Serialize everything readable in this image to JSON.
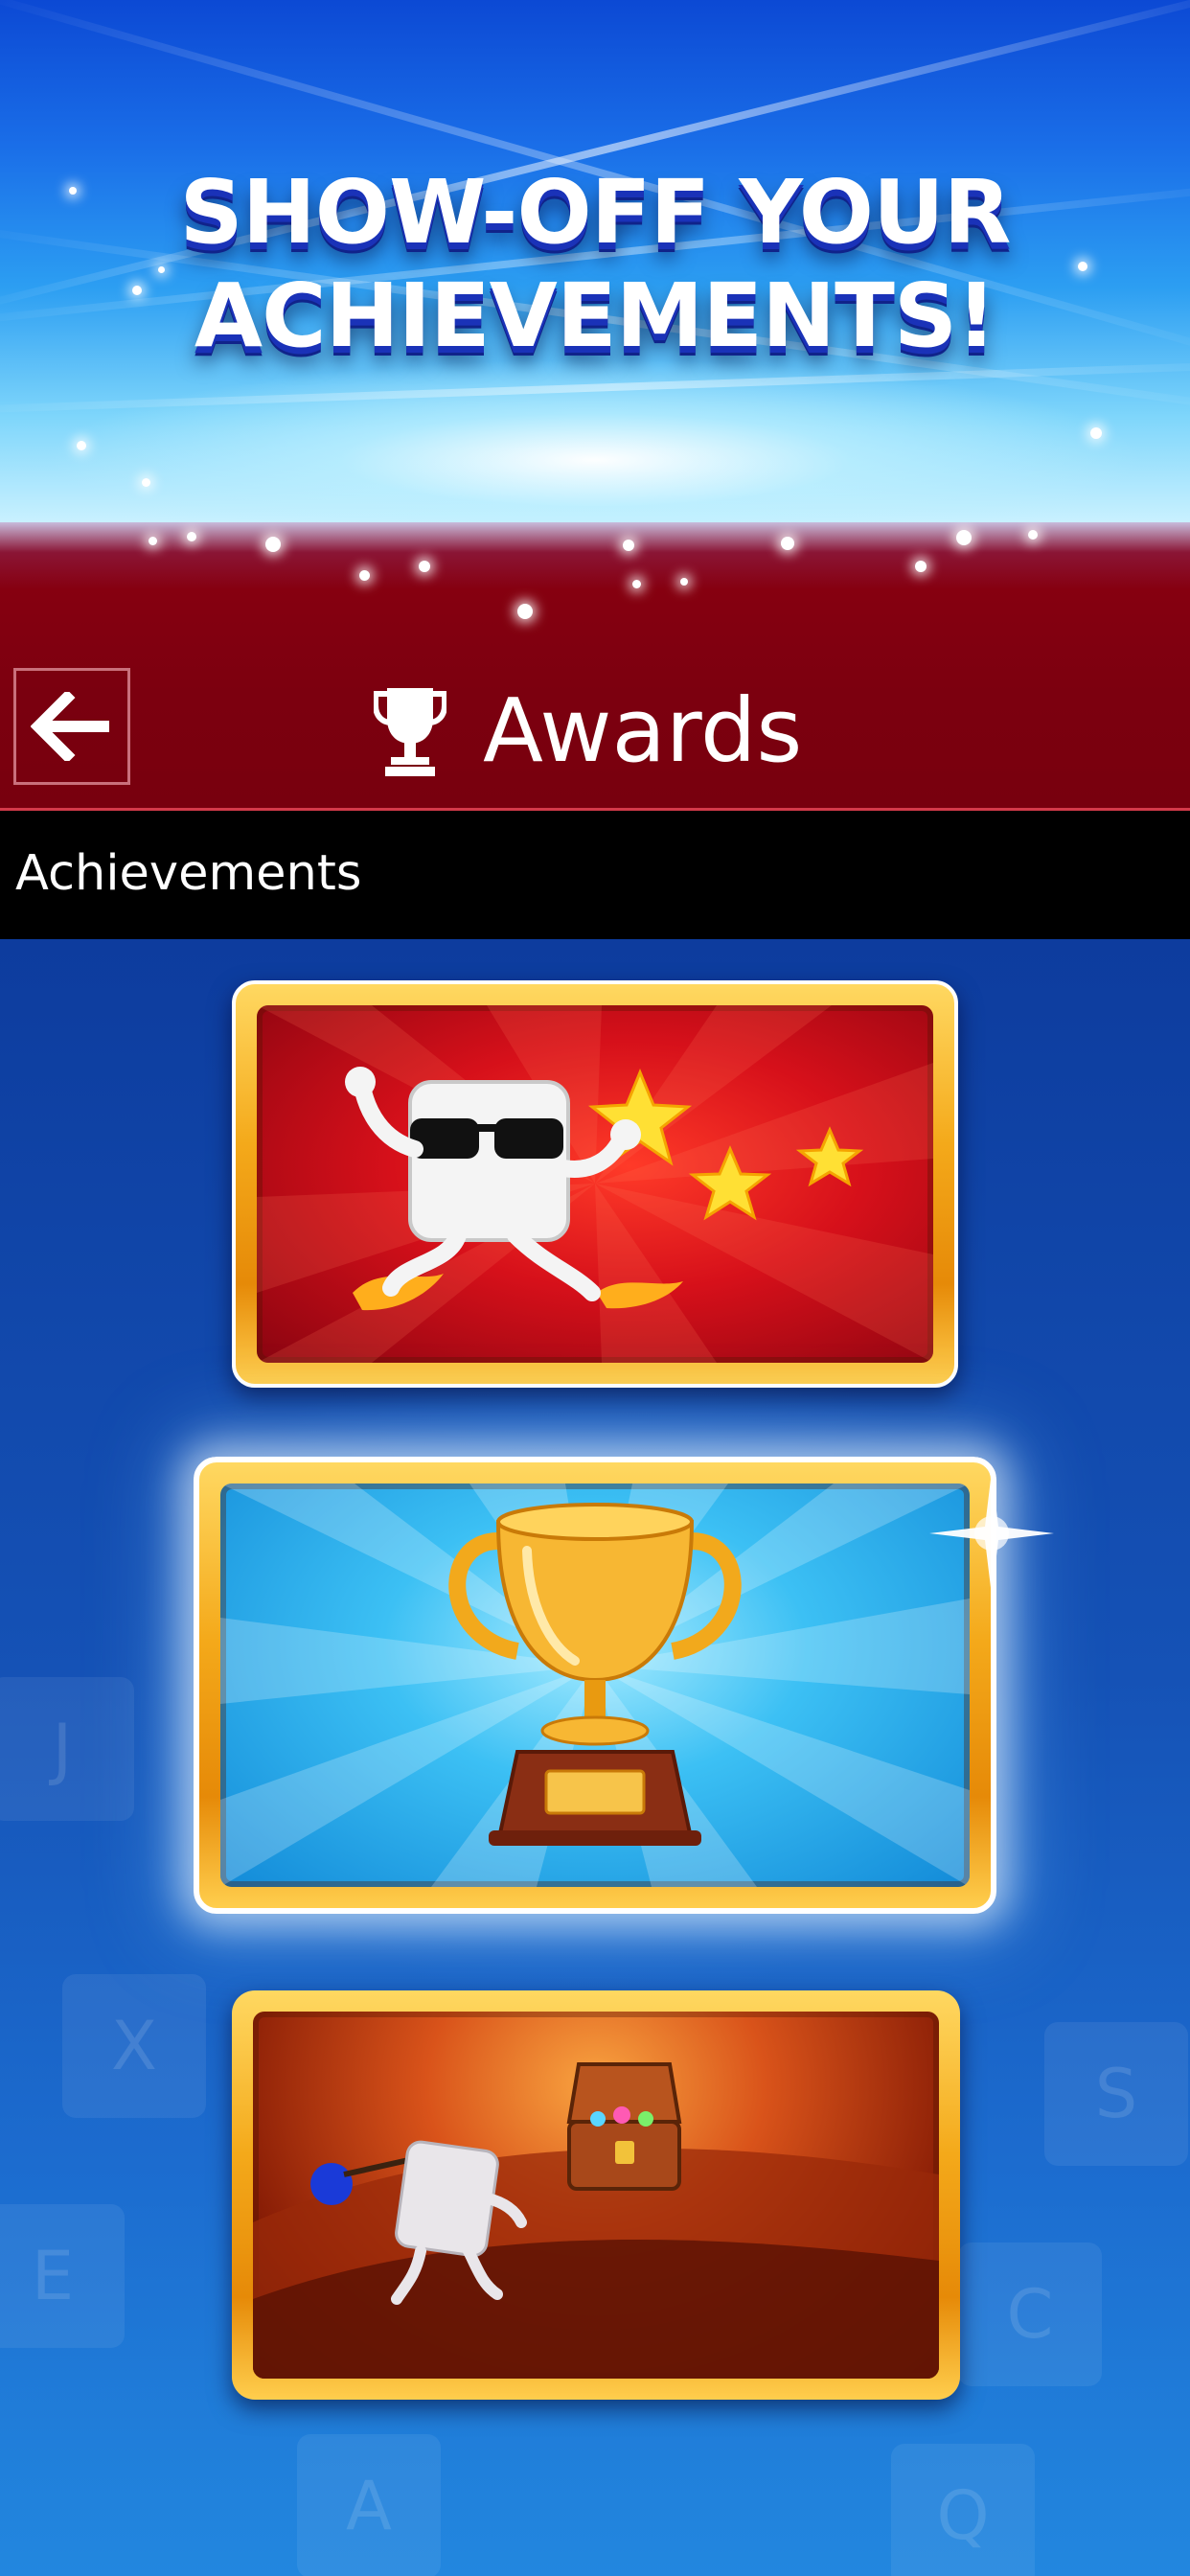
{
  "hero": {
    "headline_line1": "SHOW-OFF YOUR",
    "headline_line2": "ACHIEVEMENTS!"
  },
  "titlebar": {
    "back_icon": "arrow-left-icon",
    "trophy_icon": "trophy-icon",
    "title": "Awards"
  },
  "section": {
    "label": "Achievements"
  },
  "cards": [
    {
      "name": "speed-achievement-card",
      "art": "running-tile-with-sunglasses-and-stars"
    },
    {
      "name": "trophy-achievement-card",
      "art": "golden-trophy"
    },
    {
      "name": "treasure-achievement-card",
      "art": "tile-walking-to-treasure-chest"
    }
  ],
  "colors": {
    "hero_blue": "#1a6ee8",
    "band_red": "#7c000f",
    "section_black": "#000000",
    "card_gold": "#f4a91a",
    "background_blue": "#1552b6"
  }
}
